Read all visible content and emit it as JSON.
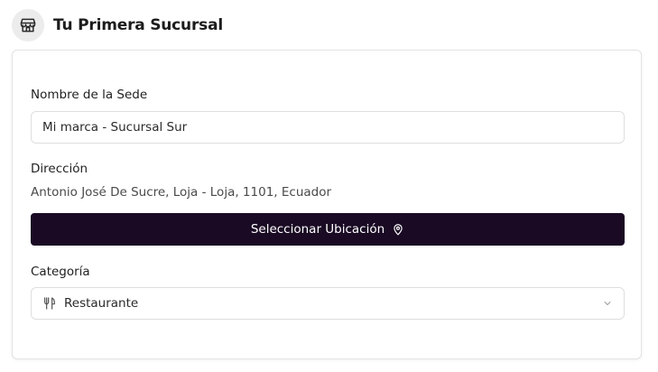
{
  "header": {
    "icon": "store-icon",
    "title": "Tu Primera Sucursal"
  },
  "form": {
    "name": {
      "label": "Nombre de la Sede",
      "value": "Mi marca - Sucursal Sur"
    },
    "address": {
      "label": "Dirección",
      "value": "Antonio José De Sucre, Loja - Loja, 1101, Ecuador"
    },
    "location_button": {
      "label": "Seleccionar Ubicación",
      "icon": "map-pin-icon"
    },
    "category": {
      "label": "Categoría",
      "selected": "Restaurante",
      "icon": "utensils-icon"
    }
  },
  "colors": {
    "button_bg": "#1a0a24",
    "border": "#dedede"
  }
}
